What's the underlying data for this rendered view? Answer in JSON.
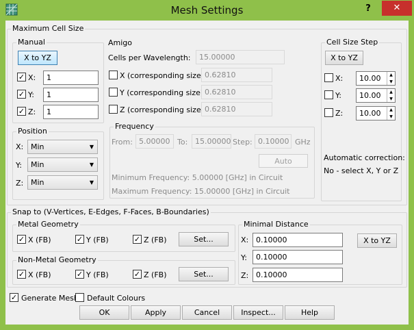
{
  "window": {
    "title": "Mesh Settings",
    "help_label": "?",
    "close_label": "✕"
  },
  "max_cell_size": {
    "label": "Maximum Cell Size",
    "manual": {
      "label": "Manual",
      "x_to_yz": "X to YZ",
      "x": {
        "label": "X:",
        "value": "1",
        "checked": true
      },
      "y": {
        "label": "Y:",
        "value": "1",
        "checked": true
      },
      "z": {
        "label": "Z:",
        "value": "1",
        "checked": true
      }
    },
    "position": {
      "label": "Position",
      "x": {
        "label": "X:",
        "value": "Min"
      },
      "y": {
        "label": "Y:",
        "value": "Min"
      },
      "z": {
        "label": "Z:",
        "value": "Min"
      }
    },
    "amigo": {
      "label": "Amigo",
      "cpw_label": "Cells per Wavelength:",
      "cpw_value": "15.00000",
      "x": {
        "label": "X (corresponding size)",
        "value": "0.62810"
      },
      "y": {
        "label": "Y (corresponding size)",
        "value": "0.62810"
      },
      "z": {
        "label": "Z (corresponding size)",
        "value": "0.62810"
      },
      "frequency": {
        "label": "Frequency",
        "from_label": "From:",
        "from_value": "5.00000",
        "to_label": "To:",
        "to_value": "15.00000",
        "step_label": "Step:",
        "step_value": "0.10000",
        "unit": "GHz",
        "auto": "Auto",
        "min_text": "Minimum Frequency: 5.00000 [GHz] in Circuit",
        "max_text": "Maximum Frequency: 15.00000 [GHz] in Circuit"
      }
    },
    "cell_step": {
      "label": "Cell Size Step",
      "x_to_yz": "X to YZ",
      "x": {
        "label": "X:",
        "value": "10.00"
      },
      "y": {
        "label": "Y:",
        "value": "10.00"
      },
      "z": {
        "label": "Z:",
        "value": "10.00"
      },
      "auto_correction": "Automatic correction:",
      "auto_note": "No - select X, Y or Z"
    }
  },
  "snap": {
    "label": "Snap to (V-Vertices, E-Edges, F-Faces, B-Boundaries)",
    "metal": {
      "label": "Metal Geometry",
      "x": "X (FB)",
      "y": "Y (FB)",
      "z": "Z (FB)",
      "set": "Set..."
    },
    "nonmetal": {
      "label": "Non-Metal Geometry",
      "x": "X (FB)",
      "y": "Y (FB)",
      "z": "Z (FB)",
      "set": "Set..."
    },
    "min_distance": {
      "label": "Minimal Distance",
      "x_label": "X:",
      "x_value": "0.10000",
      "y_label": "Y:",
      "y_value": "0.10000",
      "z_label": "Z:",
      "z_value": "0.10000",
      "x_to_yz": "X to YZ"
    }
  },
  "options": {
    "generate_mesh": "Generate Mesh",
    "generate_mesh_checked": true,
    "default_colours": "Default Colours",
    "default_colours_checked": false
  },
  "buttons": {
    "ok": "OK",
    "apply": "Apply",
    "cancel": "Cancel",
    "inspect": "Inspect...",
    "help": "Help"
  },
  "colors": {
    "frame": "#8fc04a",
    "close": "#c7302c",
    "panel": "#f0f0f0"
  }
}
